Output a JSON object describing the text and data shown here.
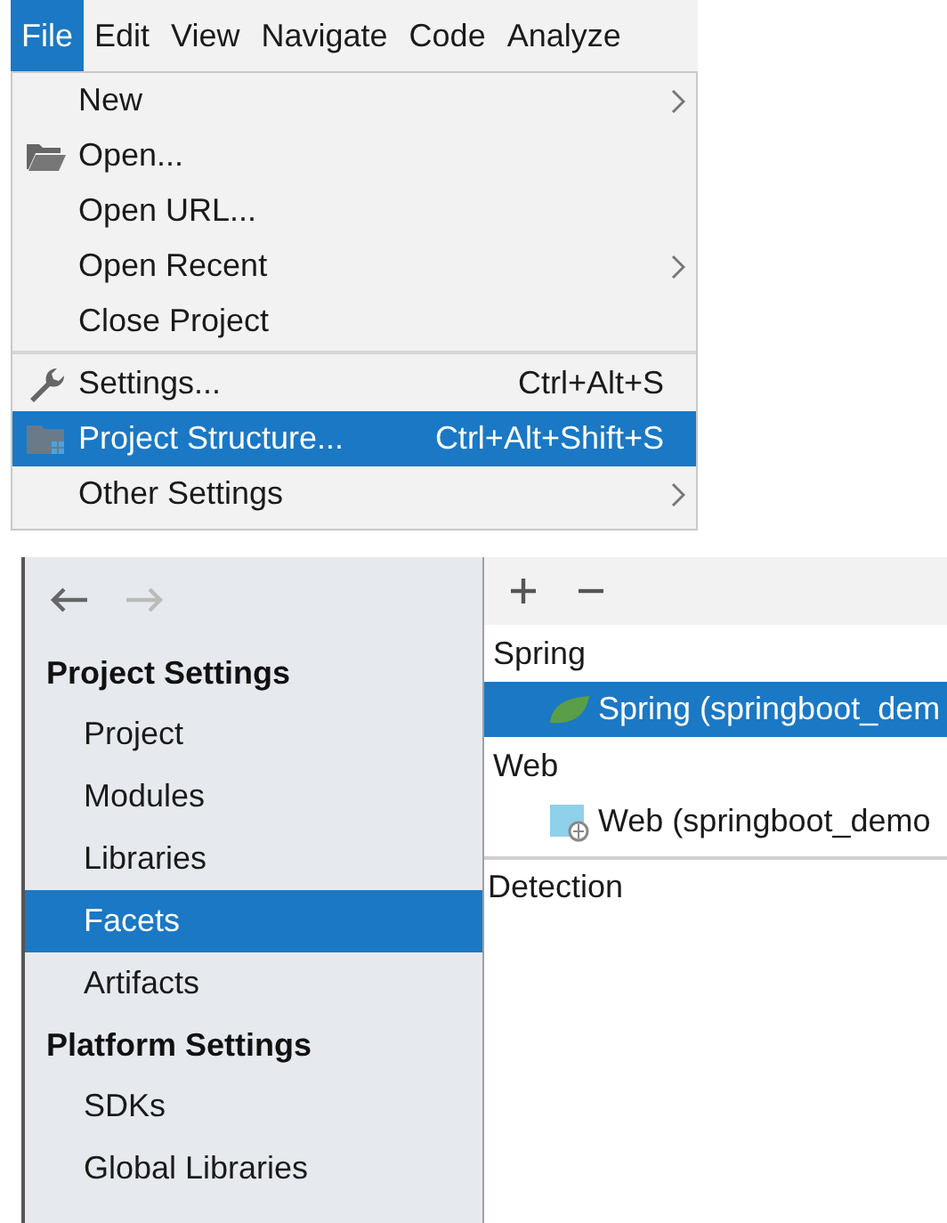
{
  "menu_bar": [
    {
      "label": "File",
      "selected": true
    },
    {
      "label": "Edit",
      "selected": false
    },
    {
      "label": "View",
      "selected": false
    },
    {
      "label": "Navigate",
      "selected": false
    },
    {
      "label": "Code",
      "selected": false
    },
    {
      "label": "Analyze",
      "selected": false
    }
  ],
  "file_menu": [
    {
      "kind": "plain",
      "label": "New",
      "submenu": true,
      "selected": false
    },
    {
      "kind": "folder",
      "label": "Open...",
      "submenu": false,
      "selected": false
    },
    {
      "kind": "plain",
      "label": "Open URL...",
      "submenu": false,
      "selected": false
    },
    {
      "kind": "plain",
      "label": "Open Recent",
      "submenu": true,
      "selected": false
    },
    {
      "kind": "plain",
      "label": "Close Project",
      "submenu": false,
      "selected": false
    },
    {
      "kind": "separator"
    },
    {
      "kind": "wrench",
      "label": "Settings...",
      "shortcut": "Ctrl+Alt+S",
      "submenu": false,
      "selected": false
    },
    {
      "kind": "structure",
      "label": "Project Structure...",
      "shortcut": "Ctrl+Alt+Shift+S",
      "submenu": false,
      "selected": true
    },
    {
      "kind": "plain",
      "label": "Other Settings",
      "submenu": true,
      "selected": false
    }
  ],
  "sidebar": {
    "back_enabled": true,
    "forward_enabled": false,
    "sections": [
      {
        "title": "Project Settings",
        "items": [
          {
            "label": "Project",
            "selected": false
          },
          {
            "label": "Modules",
            "selected": false
          },
          {
            "label": "Libraries",
            "selected": false
          },
          {
            "label": "Facets",
            "selected": true
          },
          {
            "label": "Artifacts",
            "selected": false
          }
        ]
      },
      {
        "title": "Platform Settings",
        "items": [
          {
            "label": "SDKs",
            "selected": false
          },
          {
            "label": "Global Libraries",
            "selected": false
          }
        ]
      }
    ]
  },
  "facets": {
    "groups": [
      {
        "title": "Spring",
        "items": [
          {
            "kind": "spring",
            "label": "Spring (springboot_dem",
            "selected": true
          }
        ]
      },
      {
        "title": "Web",
        "items": [
          {
            "kind": "web",
            "label": "Web (springboot_demo",
            "selected": false
          }
        ]
      }
    ],
    "detection": "Detection"
  }
}
